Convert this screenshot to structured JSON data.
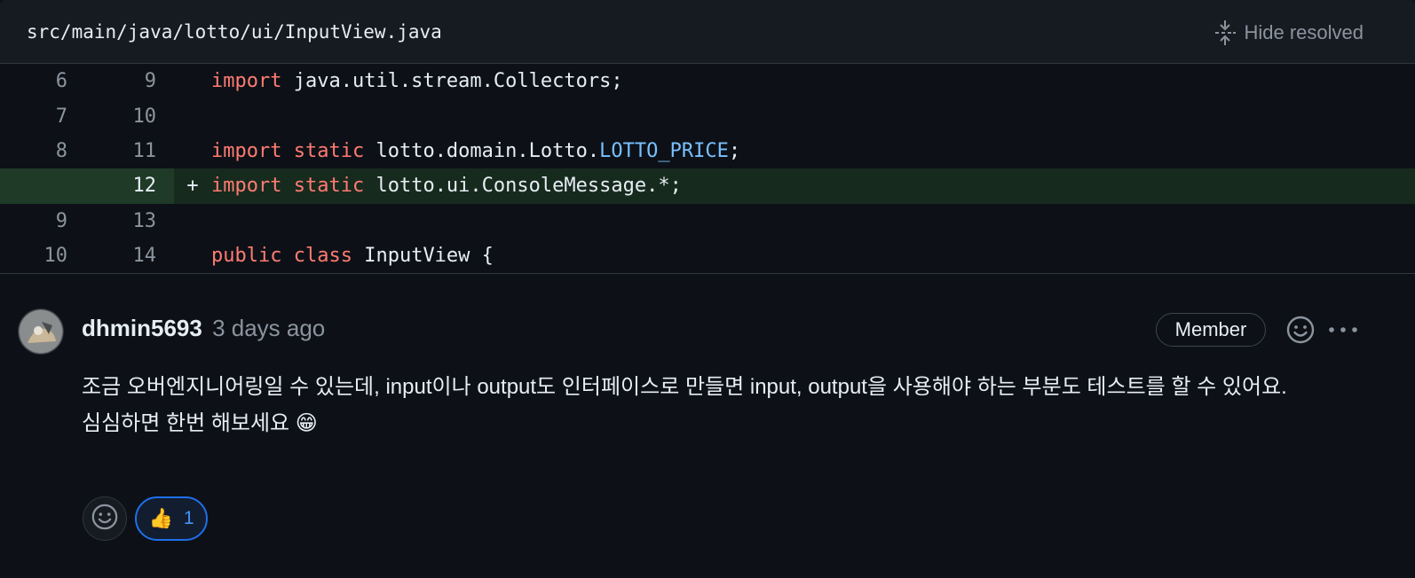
{
  "file": {
    "path": "src/main/java/lotto/ui/InputView.java",
    "hide_resolved_label": "Hide resolved"
  },
  "diff_lines": [
    {
      "old": "6",
      "new": "9",
      "marker": "",
      "added": false,
      "tokens": [
        {
          "t": "import",
          "c": "kw"
        },
        {
          "t": " java.util.stream.Collectors;",
          "c": ""
        }
      ]
    },
    {
      "old": "7",
      "new": "10",
      "marker": "",
      "added": false,
      "tokens": []
    },
    {
      "old": "8",
      "new": "11",
      "marker": "",
      "added": false,
      "tokens": [
        {
          "t": "import",
          "c": "kw"
        },
        {
          "t": " ",
          "c": ""
        },
        {
          "t": "static",
          "c": "kw"
        },
        {
          "t": " lotto.domain.Lotto.",
          "c": ""
        },
        {
          "t": "LOTTO_PRICE",
          "c": "const"
        },
        {
          "t": ";",
          "c": ""
        }
      ]
    },
    {
      "old": "",
      "new": "12",
      "marker": "+",
      "added": true,
      "tokens": [
        {
          "t": "import",
          "c": "kw"
        },
        {
          "t": " ",
          "c": ""
        },
        {
          "t": "static",
          "c": "kw"
        },
        {
          "t": " lotto.ui.ConsoleMessage.*;",
          "c": ""
        }
      ]
    },
    {
      "old": "9",
      "new": "13",
      "marker": "",
      "added": false,
      "tokens": []
    },
    {
      "old": "10",
      "new": "14",
      "marker": "",
      "added": false,
      "tokens": [
        {
          "t": "public",
          "c": "kw"
        },
        {
          "t": " ",
          "c": ""
        },
        {
          "t": "class",
          "c": "kw"
        },
        {
          "t": " InputView {",
          "c": ""
        }
      ]
    }
  ],
  "comment": {
    "author": "dhmin5693",
    "time": "3 days ago",
    "role": "Member",
    "body_lines": [
      "조금 오버엔지니어링일 수 있는데, input이나 output도 인터페이스로 만들면 input, output을 사용해야 하는 부분도 테스트를 할 수 있어요.",
      "심심하면 한번 해보세요 😁"
    ],
    "reactions": [
      {
        "emoji": "👍",
        "count": "1"
      }
    ]
  },
  "colors": {
    "background": "#0d1117",
    "header_bg": "#161b22",
    "keyword": "#ff7b72",
    "constant": "#79c0ff",
    "added_line_bg": "#172a1e",
    "reaction_border": "#1f6feb"
  },
  "icons": {
    "hide_resolved": "unfold-icon",
    "add_reaction": "smiley-icon",
    "more": "kebab-horizontal-icon"
  }
}
